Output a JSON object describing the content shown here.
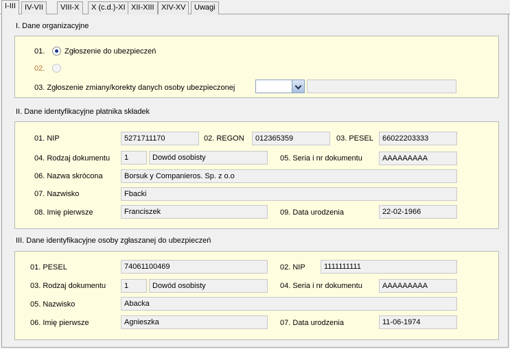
{
  "tabs": [
    "I-III",
    "IV-VII",
    "VIII-X",
    "X (c.d.)-XI",
    "XII-XIII",
    "XIV-XV",
    "Uwagi"
  ],
  "section1": {
    "title": "I. Dane organizacyjne",
    "r1_num": "01.",
    "r1_label": "Zgłoszenie do ubezpieczeń",
    "r2_num": "02.",
    "r3_label": "03. Zgłoszenie zmiany/korekty danych osoby ubezpieczonej",
    "r3_combo_value": "",
    "r3_text_value": ""
  },
  "section2": {
    "title": "II. Dane identyfikacyjne płatnika składek",
    "nip_label": "01. NIP",
    "nip": "5271711170",
    "regon_label": "02. REGON",
    "regon": "012365359",
    "pesel_label": "03. PESEL",
    "pesel": "66022203333",
    "doc_label": "04. Rodzaj dokumentu",
    "doc_code": "1",
    "doc_name": "Dowód osobisty",
    "serie_label": "05. Seria i nr dokumentu",
    "serie": "AAAAAAAAA",
    "short_label": "06. Nazwa skrócona",
    "short": "Borsuk y Companieros. Sp. z o.o",
    "surname_label": "07. Nazwisko",
    "surname": "Fbacki",
    "firstname_label": "08. Imię pierwsze",
    "firstname": "Franciszek",
    "birth_label": "09. Data urodzenia",
    "birth": "22-02-1966"
  },
  "section3": {
    "title": "III. Dane identyfikacyjne osoby zgłaszanej do ubezpieczeń",
    "pesel_label": "01. PESEL",
    "pesel": "74061100469",
    "nip_label": "02. NIP",
    "nip": "1111111111",
    "doc_label": "03. Rodzaj dokumentu",
    "doc_code": "1",
    "doc_name": "Dowód osobisty",
    "serie_label": "04. Seria i nr dokumentu",
    "serie": "AAAAAAAAA",
    "surname_label": "05. Nazwisko",
    "surname": "Abacka",
    "firstname_label": "06. Imię pierwsze",
    "firstname": "Agnieszka",
    "birth_label": "07. Data urodzenia",
    "birth": "11-06-1974"
  }
}
